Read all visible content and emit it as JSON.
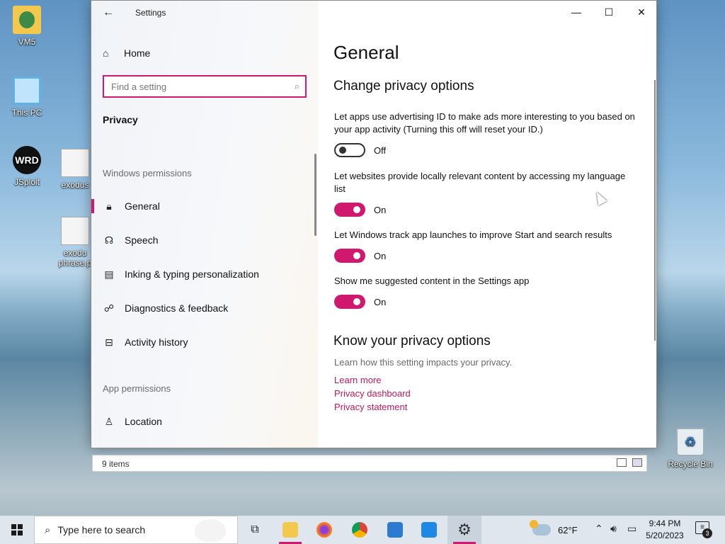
{
  "desktop": {
    "icons": [
      {
        "label": "VM5"
      },
      {
        "label": "This PC"
      },
      {
        "label": "JSploit"
      },
      {
        "label": "exodus"
      },
      {
        "label": "exodu phrase.p"
      },
      {
        "label": "Recycle Bin"
      }
    ],
    "jsploit_glyph": "WRD"
  },
  "window": {
    "title": "Settings",
    "back_icon": "←",
    "minimize_icon": "—",
    "maximize_icon": "☐",
    "close_icon": "✕"
  },
  "sidebar": {
    "home_label": "Home",
    "search_placeholder": "Find a setting",
    "section_title": "Privacy",
    "windows_permissions_label": "Windows permissions",
    "windows_items": [
      {
        "label": "General",
        "icon": "lock-icon",
        "glyph": "🔒︎",
        "active": true
      },
      {
        "label": "Speech",
        "icon": "speech-icon",
        "glyph": "☊",
        "active": false
      },
      {
        "label": "Inking & typing personalization",
        "icon": "clipboard-icon",
        "glyph": "▤",
        "active": false
      },
      {
        "label": "Diagnostics & feedback",
        "icon": "feedback-icon",
        "glyph": "☍",
        "active": false
      },
      {
        "label": "Activity history",
        "icon": "activity-icon",
        "glyph": "⊟",
        "active": false
      }
    ],
    "app_permissions_label": "App permissions",
    "app_items": [
      {
        "label": "Location",
        "icon": "location-icon",
        "glyph": "♙"
      }
    ]
  },
  "content": {
    "page_title": "General",
    "section1_title": "Change privacy options",
    "options": [
      {
        "description": "Let apps use advertising ID to make ads more interesting to you based on your app activity (Turning this off will reset your ID.)",
        "state": "Off"
      },
      {
        "description": "Let websites provide locally relevant content by accessing my language list",
        "state": "On"
      },
      {
        "description": "Let Windows track app launches to improve Start and search results",
        "state": "On"
      },
      {
        "description": "Show me suggested content in the Settings app",
        "state": "On"
      }
    ],
    "section2_title": "Know your privacy options",
    "section2_desc": "Learn how this setting impacts your privacy.",
    "links": [
      "Learn more",
      "Privacy dashboard",
      "Privacy statement"
    ]
  },
  "explorer_status": {
    "item_count": "9 items"
  },
  "taskbar": {
    "search_placeholder": "Type here to search",
    "weather_temp": "62°F",
    "time": "9:44 PM",
    "date": "5/20/2023",
    "notification_count": "3",
    "accent_color": "#d0186e"
  }
}
